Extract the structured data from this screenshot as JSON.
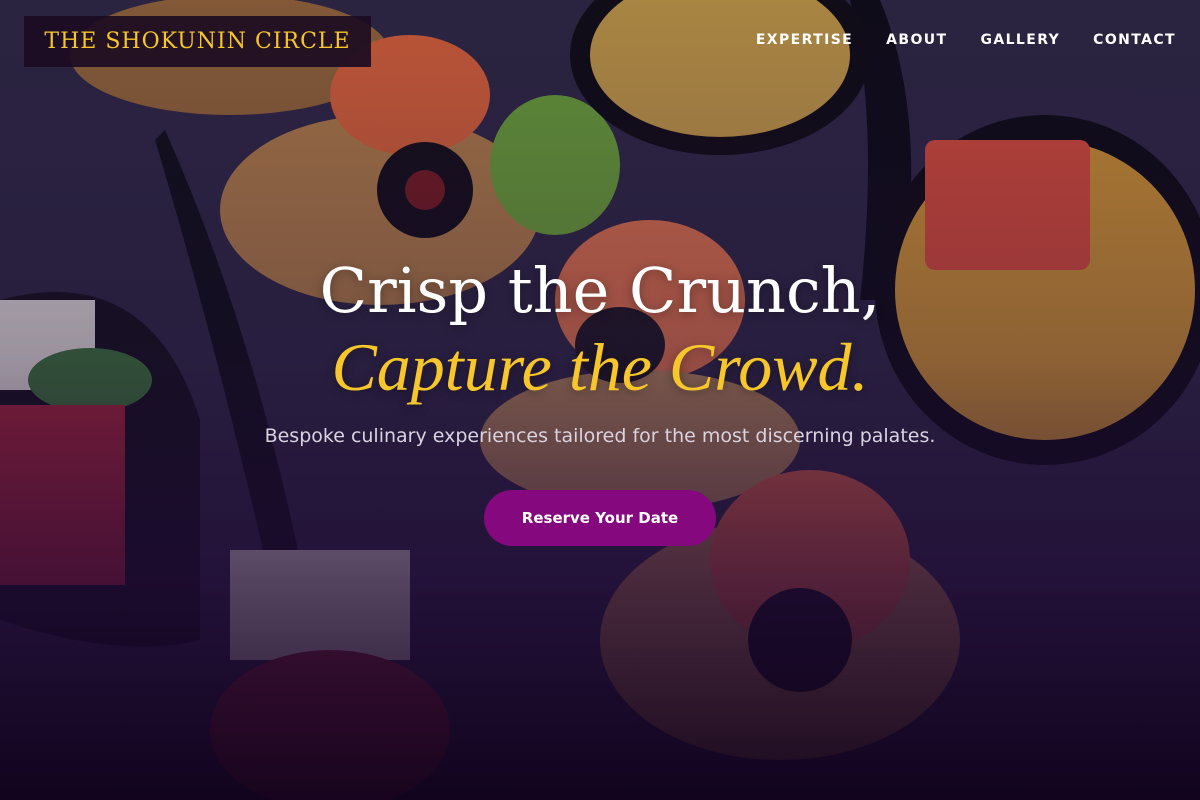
{
  "brand": {
    "name": "THE SHOKUNIN CIRCLE"
  },
  "nav": {
    "items": [
      {
        "label": "EXPERTISE"
      },
      {
        "label": "ABOUT"
      },
      {
        "label": "GALLERY"
      },
      {
        "label": "CONTACT"
      }
    ]
  },
  "hero": {
    "headline": "Crisp the Crunch,",
    "headline_accent": "Capture the Crowd.",
    "subtitle": "Bespoke culinary experiences tailored for the most discerning palates.",
    "cta_label": "Reserve Your Date"
  },
  "colors": {
    "accent": "#f6c62a",
    "button": "#86087e"
  }
}
